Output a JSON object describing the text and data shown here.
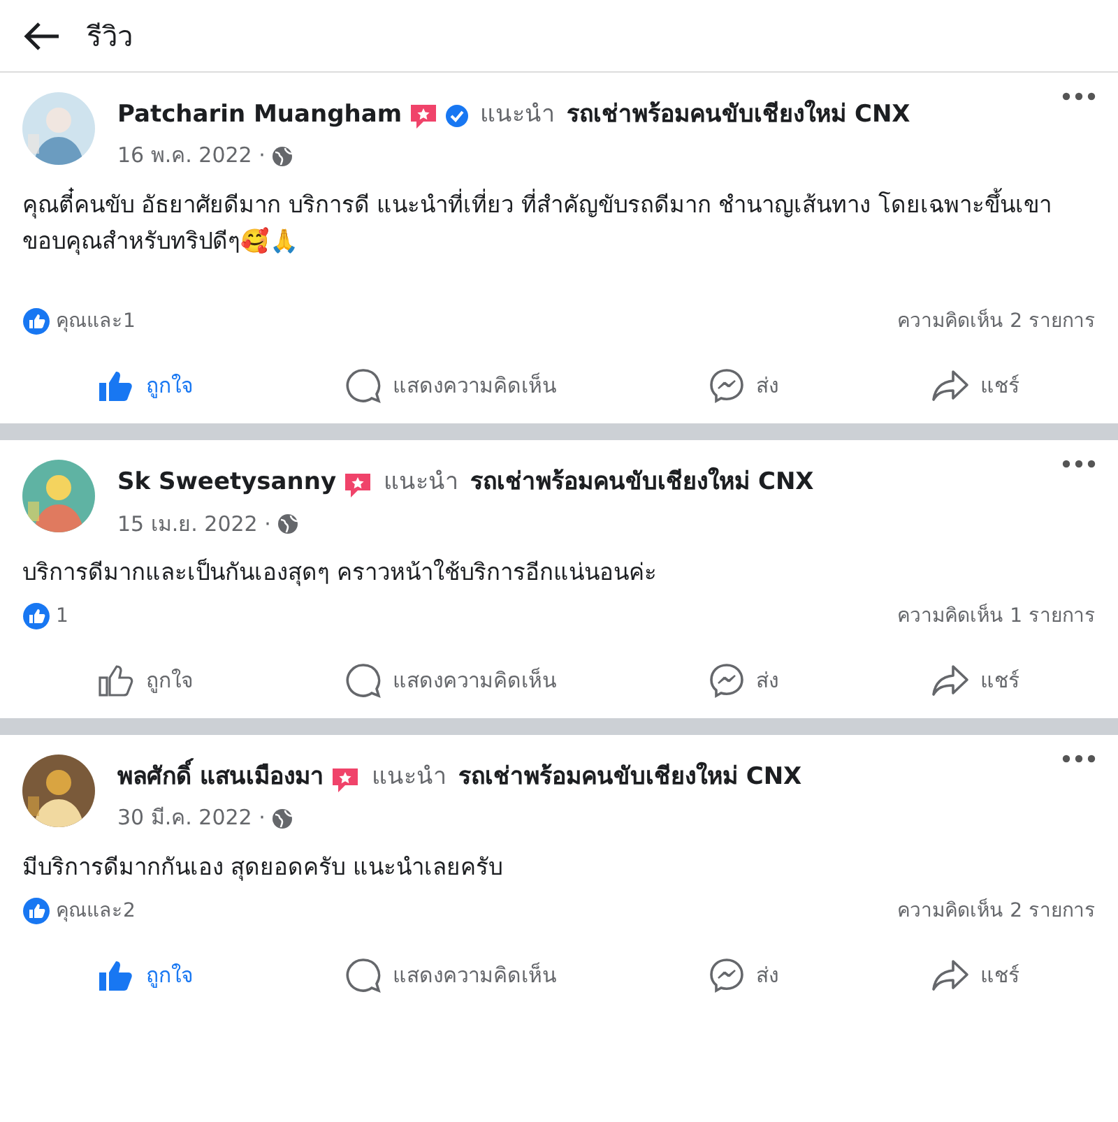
{
  "header": {
    "title": "รีวิว"
  },
  "posts": [
    {
      "author": "Patcharin Muangham",
      "verified": true,
      "recommends": "แนะนำ",
      "page": "รถเช่าพร้อมคนขับเชียงใหม่ CNX",
      "date": "16 พ.ค. 2022 ·",
      "text": "คุณตี๋คนขับ อัธยาศัยดีมาก บริการดี แนะนำที่เที่ยว ที่สำคัญขับรถดีมาก ชำนาญเส้นทาง โดยเฉพาะขึ้นเขา ขอบคุณสำหรับทริปดีๆ🥰🙏",
      "reactions": "คุณและ1",
      "comments": "ความคิดเห็น 2 รายการ",
      "liked": true,
      "actions": [
        {
          "kind": "like",
          "label": "ถูกใจ"
        },
        {
          "kind": "comment",
          "label": "แสดงความคิดเห็น"
        },
        {
          "kind": "send",
          "label": "ส่ง"
        },
        {
          "kind": "share",
          "label": "แชร์"
        }
      ]
    },
    {
      "author": "Sk Sweetysanny",
      "verified": false,
      "recommends": "แนะนำ",
      "page": "รถเช่าพร้อมคนขับเชียงใหม่ CNX",
      "date": "15 เม.ย. 2022 ·",
      "text": "บริการดีมากและเป็นกันเองสุดๆ คราวหน้าใช้บริการอีกแน่นอนค่ะ",
      "reactions": "1",
      "comments": "ความคิดเห็น 1 รายการ",
      "liked": false,
      "actions": [
        {
          "kind": "like",
          "label": "ถูกใจ"
        },
        {
          "kind": "comment",
          "label": "แสดงความคิดเห็น"
        },
        {
          "kind": "send",
          "label": "ส่ง"
        },
        {
          "kind": "share",
          "label": "แชร์"
        }
      ]
    },
    {
      "author": "พลศักดิ์ แสนเมืองมา",
      "verified": false,
      "recommends": "แนะนำ",
      "page": "รถเช่าพร้อมคนขับเชียงใหม่ CNX",
      "date": "30 มี.ค. 2022 ·",
      "text": "มีบริการดีมากกันเอง สุดยอดครับ แนะนำเลยครับ",
      "reactions": "คุณและ2",
      "comments": "ความคิดเห็น 2 รายการ",
      "liked": true,
      "actions": [
        {
          "kind": "like",
          "label": "ถูกใจ"
        },
        {
          "kind": "comment",
          "label": "แสดงความคิดเห็น"
        },
        {
          "kind": "send",
          "label": "ส่ง"
        },
        {
          "kind": "share",
          "label": "แชร์"
        }
      ]
    }
  ]
}
